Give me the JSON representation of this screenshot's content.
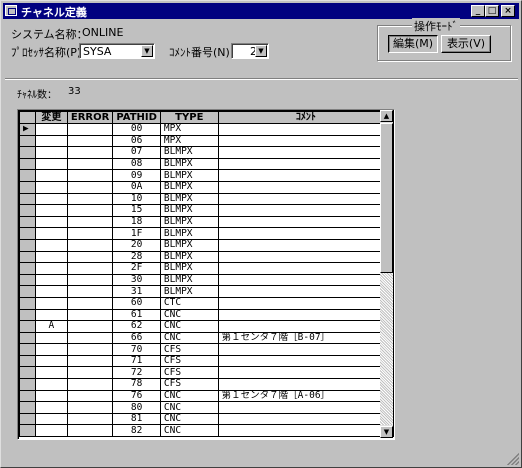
{
  "window": {
    "title": "チャネル定義",
    "minimize": "_",
    "maximize": "□",
    "close": "×"
  },
  "form": {
    "system_label": "システム名称：",
    "system_value": "ONLINE",
    "processor_label": "ﾌﾟﾛｾｯｻ名称(P)：",
    "processor_value": "SYSA",
    "comment_no_label": "ｺﾒﾝﾄ番号(N)：",
    "comment_no_value": "2"
  },
  "mode_group": {
    "title": "操作ﾓｰﾄﾞ",
    "edit_label": "編集(M)",
    "view_label": "表示(V)"
  },
  "channel_count": {
    "label": "ﾁｬﾈﾙ数：",
    "value": "33"
  },
  "grid": {
    "columns": [
      "",
      "変更",
      "ERROR",
      "PATHID",
      "TYPE",
      "ｺﾒﾝﾄ"
    ],
    "current_row_marker": "▶",
    "rows": [
      {
        "change": "",
        "error": "",
        "pathid": "00",
        "type": "MPX",
        "comment": ""
      },
      {
        "change": "",
        "error": "",
        "pathid": "06",
        "type": "MPX",
        "comment": ""
      },
      {
        "change": "",
        "error": "",
        "pathid": "07",
        "type": "BLMPX",
        "comment": ""
      },
      {
        "change": "",
        "error": "",
        "pathid": "08",
        "type": "BLMPX",
        "comment": ""
      },
      {
        "change": "",
        "error": "",
        "pathid": "09",
        "type": "BLMPX",
        "comment": ""
      },
      {
        "change": "",
        "error": "",
        "pathid": "0A",
        "type": "BLMPX",
        "comment": ""
      },
      {
        "change": "",
        "error": "",
        "pathid": "10",
        "type": "BLMPX",
        "comment": ""
      },
      {
        "change": "",
        "error": "",
        "pathid": "15",
        "type": "BLMPX",
        "comment": ""
      },
      {
        "change": "",
        "error": "",
        "pathid": "18",
        "type": "BLMPX",
        "comment": ""
      },
      {
        "change": "",
        "error": "",
        "pathid": "1F",
        "type": "BLMPX",
        "comment": ""
      },
      {
        "change": "",
        "error": "",
        "pathid": "20",
        "type": "BLMPX",
        "comment": ""
      },
      {
        "change": "",
        "error": "",
        "pathid": "28",
        "type": "BLMPX",
        "comment": ""
      },
      {
        "change": "",
        "error": "",
        "pathid": "2F",
        "type": "BLMPX",
        "comment": ""
      },
      {
        "change": "",
        "error": "",
        "pathid": "30",
        "type": "BLMPX",
        "comment": ""
      },
      {
        "change": "",
        "error": "",
        "pathid": "31",
        "type": "BLMPX",
        "comment": ""
      },
      {
        "change": "",
        "error": "",
        "pathid": "60",
        "type": "CTC",
        "comment": ""
      },
      {
        "change": "",
        "error": "",
        "pathid": "61",
        "type": "CNC",
        "comment": ""
      },
      {
        "change": "A",
        "error": "",
        "pathid": "62",
        "type": "CNC",
        "comment": ""
      },
      {
        "change": "",
        "error": "",
        "pathid": "66",
        "type": "CNC",
        "comment": "第１センタ７階［B-07］"
      },
      {
        "change": "",
        "error": "",
        "pathid": "70",
        "type": "CFS",
        "comment": ""
      },
      {
        "change": "",
        "error": "",
        "pathid": "71",
        "type": "CFS",
        "comment": ""
      },
      {
        "change": "",
        "error": "",
        "pathid": "72",
        "type": "CFS",
        "comment": ""
      },
      {
        "change": "",
        "error": "",
        "pathid": "78",
        "type": "CFS",
        "comment": ""
      },
      {
        "change": "",
        "error": "",
        "pathid": "76",
        "type": "CNC",
        "comment": "第１センタ７階［A-06］"
      },
      {
        "change": "",
        "error": "",
        "pathid": "80",
        "type": "CNC",
        "comment": ""
      },
      {
        "change": "",
        "error": "",
        "pathid": "81",
        "type": "CNC",
        "comment": ""
      },
      {
        "change": "",
        "error": "",
        "pathid": "82",
        "type": "CNC",
        "comment": ""
      }
    ]
  },
  "scrollbar": {
    "up": "▲",
    "down": "▼"
  }
}
